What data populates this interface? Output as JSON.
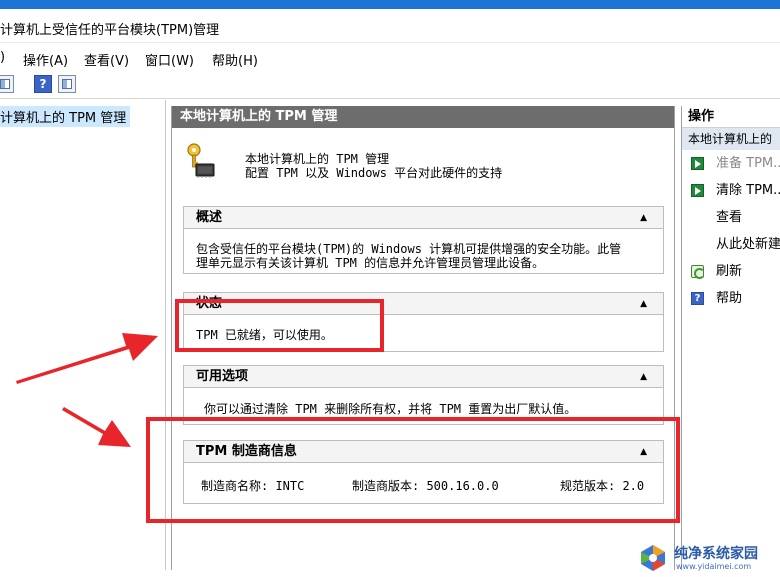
{
  "window": {
    "title": "计算机上受信任的平台模块(TPM)管理"
  },
  "menu": [
    {
      "label": ")"
    },
    {
      "label": "操作(A)"
    },
    {
      "label": "查看(V)"
    },
    {
      "label": "窗口(W)"
    },
    {
      "label": "帮助(H)"
    }
  ],
  "toolbar": {
    "help_glyph": "?"
  },
  "tree": {
    "selected_item": "计算机上的 TPM 管理"
  },
  "center": {
    "header": "本地计算机上的 TPM 管理",
    "intro_title": "本地计算机上的 TPM 管理",
    "intro_desc": "配置 TPM 以及 Windows 平台对此硬件的支持",
    "sections": [
      {
        "title": "概述",
        "lines": [
          "包含受信任的平台模块(TPM)的 Windows 计算机可提供增强的安全功能。此管",
          "理单元显示有关该计算机 TPM 的信息并允许管理员管理此设备。"
        ]
      },
      {
        "title": "状态",
        "lines": [
          "TPM 已就绪，可以使用。"
        ]
      },
      {
        "title": "可用选项",
        "lines": [
          "你可以通过清除 TPM 来删除所有权，并将 TPM 重置为出厂默认值。"
        ]
      },
      {
        "title": "TPM 制造商信息",
        "manufacturer_name": "制造商名称: INTC",
        "manufacturer_version": "制造商版本: 500.16.0.0",
        "spec_version": "规范版本: 2.0"
      }
    ],
    "collapse_glyph": "▲"
  },
  "actions": {
    "header": "操作",
    "subheader": "本地计算机上的",
    "items": [
      {
        "label": "准备 TPM...",
        "icon": "green-arrow-icon",
        "disabled": true
      },
      {
        "label": "清除 TPM...",
        "icon": "green-arrow-icon",
        "disabled": false
      },
      {
        "label": "查看",
        "icon": "",
        "disabled": false
      },
      {
        "label": "从此处新建",
        "icon": "",
        "disabled": false
      },
      {
        "label": "刷新",
        "icon": "refresh-icon",
        "disabled": false
      },
      {
        "label": "帮助",
        "icon": "help-icon",
        "disabled": false
      }
    ]
  },
  "annotation": {
    "color": "#e8252b"
  },
  "watermark": {
    "title": "纯净系统家园",
    "url": "www.yidaimei.com"
  }
}
